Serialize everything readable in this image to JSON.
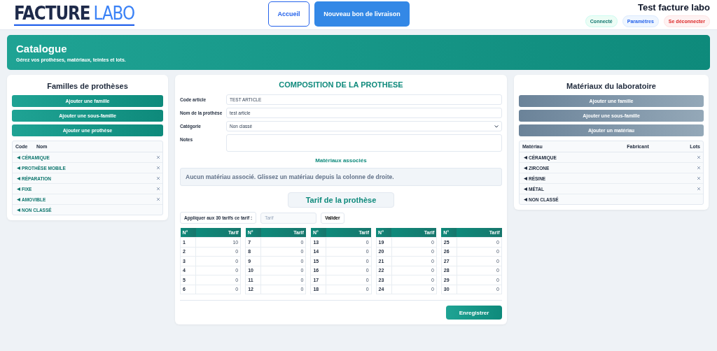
{
  "header": {
    "logo": {
      "word_1": "FACTURE",
      "word_2": "LABO"
    },
    "nav": [
      {
        "label": "Accueil",
        "kind": "outline"
      },
      {
        "label": "Nouveau bon de livraison",
        "kind": "primary"
      }
    ],
    "user": "Test facture labo",
    "badges": [
      {
        "label": "Connecté",
        "kind": "status"
      },
      {
        "label": "Paramètres",
        "kind": "link"
      },
      {
        "label": "Se déconnecter",
        "kind": "danger"
      }
    ]
  },
  "banner": {
    "title": "Catalogue",
    "subtitle": "Gérez vos prothèses, matériaux, teintes et lots."
  },
  "families": {
    "title": "Familles de prothèses",
    "buttons": [
      "Ajouter une famille",
      "Ajouter une sous-famille",
      "Ajouter une prothèse"
    ],
    "columns": [
      "Code",
      "Nom"
    ],
    "items": [
      {
        "name": "CÉRAMIQUE",
        "deletable": true
      },
      {
        "name": "PROTHÈSE MOBILE",
        "deletable": true
      },
      {
        "name": "RÉPARATION",
        "deletable": true
      },
      {
        "name": "FIXE",
        "deletable": true
      },
      {
        "name": "AMOVIBLE",
        "deletable": true
      },
      {
        "name": "NON CLASSÉ",
        "deletable": false
      }
    ]
  },
  "composition": {
    "title": "COMPOSITION DE LA PROTHESE",
    "fields": [
      {
        "label": "Code article",
        "value": "TEST ARTICLE",
        "kind": "text"
      },
      {
        "label": "Nom de la prothèse",
        "value": "test article",
        "kind": "text"
      },
      {
        "label": "Catégorie",
        "value": "Non classé",
        "kind": "select"
      },
      {
        "label": "Notes",
        "kind": "textarea"
      }
    ],
    "materials_title": "Matériaux associés",
    "materials_empty": "Aucun matériau associé. Glissez un matériau depuis la colonne de droite.",
    "tarif_title": "Tarif de la prothèse",
    "apply_label": "Appliquer aux 30 tarifs ce tarif :",
    "apply_placeholder": "Tarif",
    "apply_button": "Valider",
    "tarifs": [
      {
        "columns": [
          "N°",
          "Tarif"
        ],
        "rows": [
          [
            "1",
            "10"
          ],
          [
            "2",
            "0"
          ],
          [
            "3",
            "0"
          ],
          [
            "4",
            "0"
          ],
          [
            "5",
            "0"
          ],
          [
            "6",
            "0"
          ]
        ]
      },
      {
        "columns": [
          "N°",
          "Tarif"
        ],
        "rows": [
          [
            "7",
            "0"
          ],
          [
            "8",
            "0"
          ],
          [
            "9",
            "0"
          ],
          [
            "10",
            "0"
          ],
          [
            "11",
            "0"
          ],
          [
            "12",
            "0"
          ]
        ]
      },
      {
        "columns": [
          "N°",
          "Tarif"
        ],
        "rows": [
          [
            "13",
            "0"
          ],
          [
            "14",
            "0"
          ],
          [
            "15",
            "0"
          ],
          [
            "16",
            "0"
          ],
          [
            "17",
            "0"
          ],
          [
            "18",
            "0"
          ]
        ]
      },
      {
        "columns": [
          "N°",
          "Tarif"
        ],
        "rows": [
          [
            "19",
            "0"
          ],
          [
            "20",
            "0"
          ],
          [
            "21",
            "0"
          ],
          [
            "22",
            "0"
          ],
          [
            "23",
            "0"
          ],
          [
            "24",
            "0"
          ]
        ]
      },
      {
        "columns": [
          "N°",
          "Tarif"
        ],
        "rows": [
          [
            "25",
            "0"
          ],
          [
            "26",
            "0"
          ],
          [
            "27",
            "0"
          ],
          [
            "28",
            "0"
          ],
          [
            "29",
            "0"
          ],
          [
            "30",
            "0"
          ]
        ]
      }
    ],
    "save": "Enregistrer"
  },
  "materials": {
    "title": "Matériaux du laboratoire",
    "buttons": [
      "Ajouter une famille",
      "Ajouter une sous-famille",
      "Ajouter un matériau"
    ],
    "columns": [
      "Matériau",
      "Fabricant",
      "Lots"
    ],
    "items": [
      {
        "name": "CÉRAMIQUE",
        "deletable": true
      },
      {
        "name": "ZIRCONE",
        "deletable": true
      },
      {
        "name": "RÉSINE",
        "deletable": true
      },
      {
        "name": "MÉTAL",
        "deletable": true
      },
      {
        "name": "NON CLASSÉ",
        "deletable": false
      }
    ]
  }
}
